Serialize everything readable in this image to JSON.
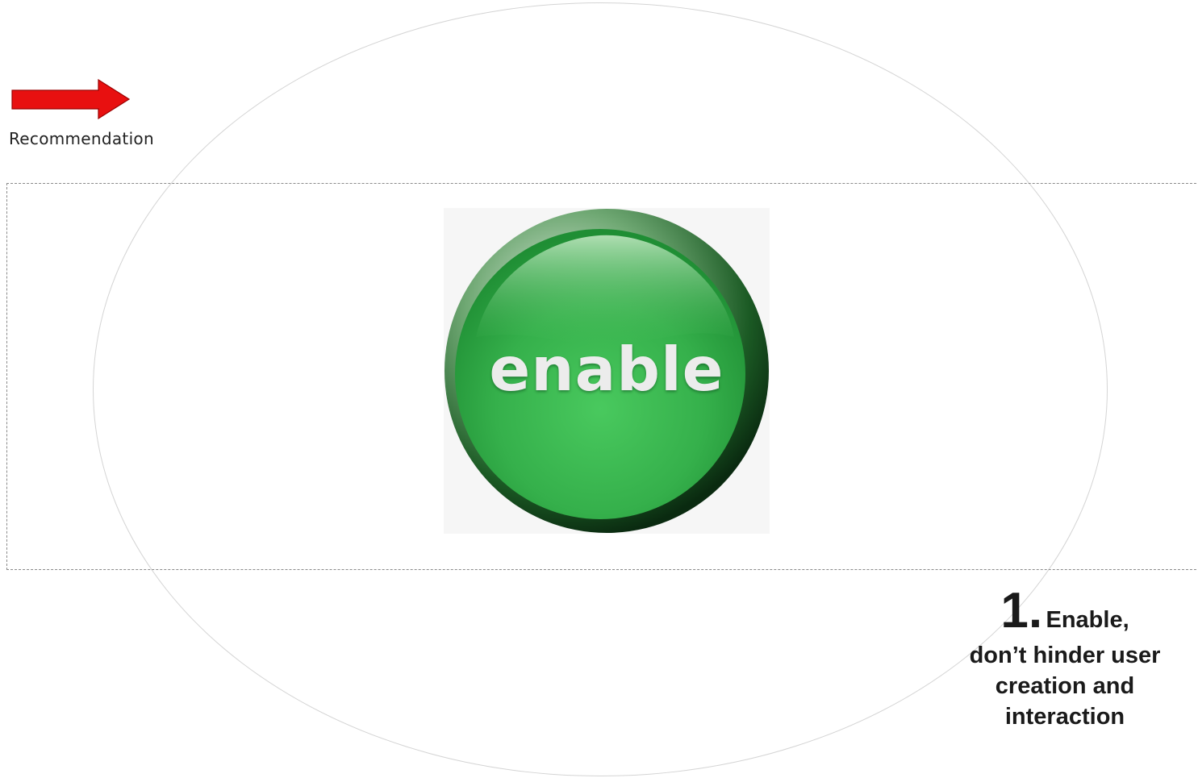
{
  "arrow": {
    "label": "Recommendation",
    "color": "#e81010",
    "icon": "arrow-right-icon"
  },
  "button": {
    "label": "enable",
    "color": "#3bb34f"
  },
  "caption": {
    "number": "1",
    "first_line": "Enable,",
    "rest": "don’t hinder user creation and interaction"
  }
}
